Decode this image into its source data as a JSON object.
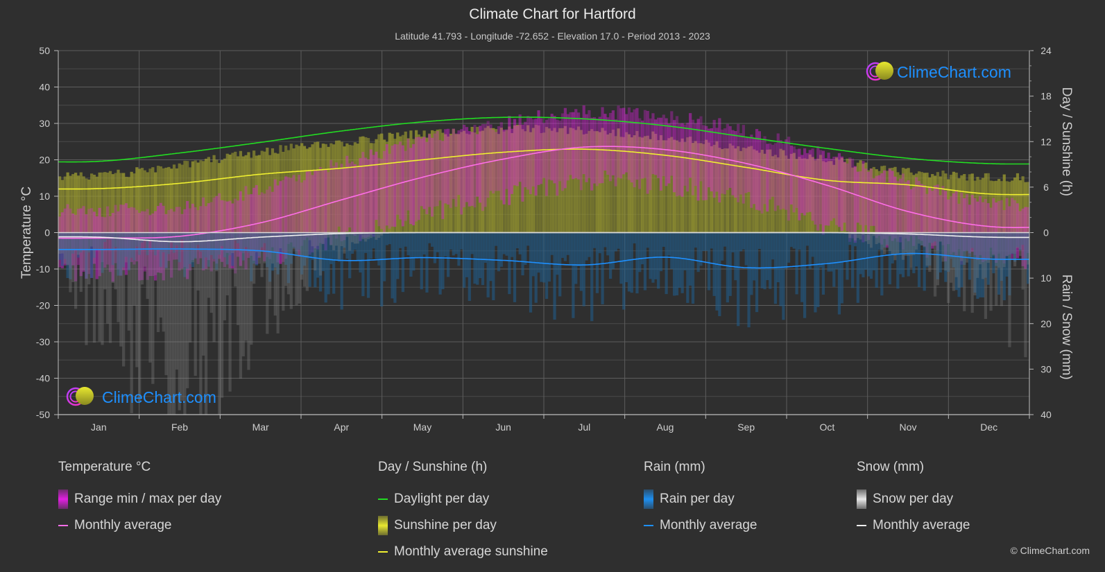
{
  "header": {
    "title": "Climate Chart for Hartford",
    "subtitle": "Latitude 41.793 - Longitude -72.652 - Elevation 17.0 - Period 2013 - 2023"
  },
  "watermark": "ClimeChart.com",
  "copyright": "© ClimeChart.com",
  "colors": {
    "background": "#2f2f2f",
    "grid": "#5a5a5a",
    "temp_range": "#e020e0",
    "temp_avg": "#ff6ee8",
    "daylight": "#22dd22",
    "sunshine_fill": "#9a9a30",
    "sunshine_avg": "#f0f030",
    "rain_fill": "#1f5f8f",
    "rain_avg": "#1e90ff",
    "snow_fill": "#808080",
    "snow_avg": "#f0f0f0",
    "logo_text": "#1e90ff"
  },
  "legend": {
    "groups": [
      {
        "title": "Temperature °C",
        "items": [
          {
            "kind": "bar",
            "label": "Range min / max per day",
            "color": "#e020e0"
          },
          {
            "kind": "line",
            "label": "Monthly average",
            "color": "#ff6ee8"
          }
        ]
      },
      {
        "title": "Day / Sunshine (h)",
        "items": [
          {
            "kind": "line",
            "label": "Daylight per day",
            "color": "#22dd22"
          },
          {
            "kind": "bar",
            "label": "Sunshine per day",
            "color": "#e8e830"
          },
          {
            "kind": "line",
            "label": "Monthly average sunshine",
            "color": "#f0f030"
          }
        ]
      },
      {
        "title": "Rain (mm)",
        "items": [
          {
            "kind": "bar",
            "label": "Rain per day",
            "color": "#1e8ff0"
          },
          {
            "kind": "line",
            "label": "Monthly average",
            "color": "#1e90ff"
          }
        ]
      },
      {
        "title": "Snow (mm)",
        "items": [
          {
            "kind": "bar",
            "label": "Snow per day",
            "color": "#e8e8e8"
          },
          {
            "kind": "line",
            "label": "Monthly average",
            "color": "#f0f0f0"
          }
        ]
      }
    ]
  },
  "chart_data": {
    "type": "line",
    "title": "Climate Chart for Hartford",
    "categories": [
      "Jan",
      "Feb",
      "Mar",
      "Apr",
      "May",
      "Jun",
      "Jul",
      "Aug",
      "Sep",
      "Oct",
      "Nov",
      "Dec"
    ],
    "axes": {
      "left": {
        "label": "Temperature °C",
        "range": [
          -50,
          50
        ],
        "ticks": [
          "50",
          "40",
          "30",
          "20",
          "10",
          "0",
          "-10",
          "-20",
          "-30",
          "-40",
          "-50"
        ]
      },
      "right_top": {
        "label": "Day / Sunshine (h)",
        "range": [
          0,
          24
        ],
        "ticks": [
          "24",
          "18",
          "12",
          "6",
          "0"
        ]
      },
      "right_bottom": {
        "label": "Rain / Snow (mm)",
        "range": [
          0,
          40
        ],
        "ticks": [
          "10",
          "20",
          "30",
          "40"
        ]
      }
    },
    "grid": true,
    "series": [
      {
        "name": "Temperature monthly average (°C)",
        "axis": "left",
        "values": [
          -1.5,
          -1.0,
          2.7,
          9.0,
          15.2,
          20.2,
          23.5,
          22.8,
          19.0,
          13.0,
          5.8,
          1.7
        ]
      },
      {
        "name": "Temperature daily max envelope (°C)",
        "axis": "left",
        "values": [
          4,
          5,
          10,
          17,
          23,
          28,
          31,
          30,
          26,
          19,
          12,
          6
        ]
      },
      {
        "name": "Temperature daily min envelope (°C)",
        "axis": "left",
        "values": [
          -8,
          -7,
          -4,
          2,
          8,
          13,
          17,
          16,
          12,
          5,
          0,
          -4
        ]
      },
      {
        "name": "Daylight per day (h)",
        "axis": "right_top",
        "values": [
          9.4,
          10.5,
          11.9,
          13.4,
          14.6,
          15.2,
          15.0,
          14.1,
          12.6,
          11.1,
          9.8,
          9.1
        ]
      },
      {
        "name": "Sunshine per day envelope (h)",
        "axis": "right_top",
        "values": [
          8.1,
          9.5,
          11.2,
          12.5,
          13.6,
          14.2,
          14.1,
          13.2,
          11.7,
          10.2,
          8.7,
          7.9
        ]
      },
      {
        "name": "Monthly average sunshine (h)",
        "axis": "right_top",
        "values": [
          5.8,
          6.5,
          7.7,
          8.5,
          9.6,
          10.6,
          11.0,
          10.2,
          8.6,
          6.9,
          6.3,
          5.1
        ]
      },
      {
        "name": "Rain monthly average (mm)",
        "axis": "right_bottom",
        "values": [
          3.7,
          3.6,
          4.0,
          6.1,
          5.5,
          6.1,
          7.1,
          5.4,
          7.7,
          6.8,
          4.6,
          5.8
        ]
      },
      {
        "name": "Snow monthly average (mm)",
        "axis": "right_bottom",
        "values": [
          1.0,
          2.0,
          1.0,
          0.2,
          0.0,
          0.0,
          0.0,
          0.0,
          0.0,
          0.0,
          0.3,
          1.0
        ]
      }
    ],
    "legend_position": "bottom"
  }
}
